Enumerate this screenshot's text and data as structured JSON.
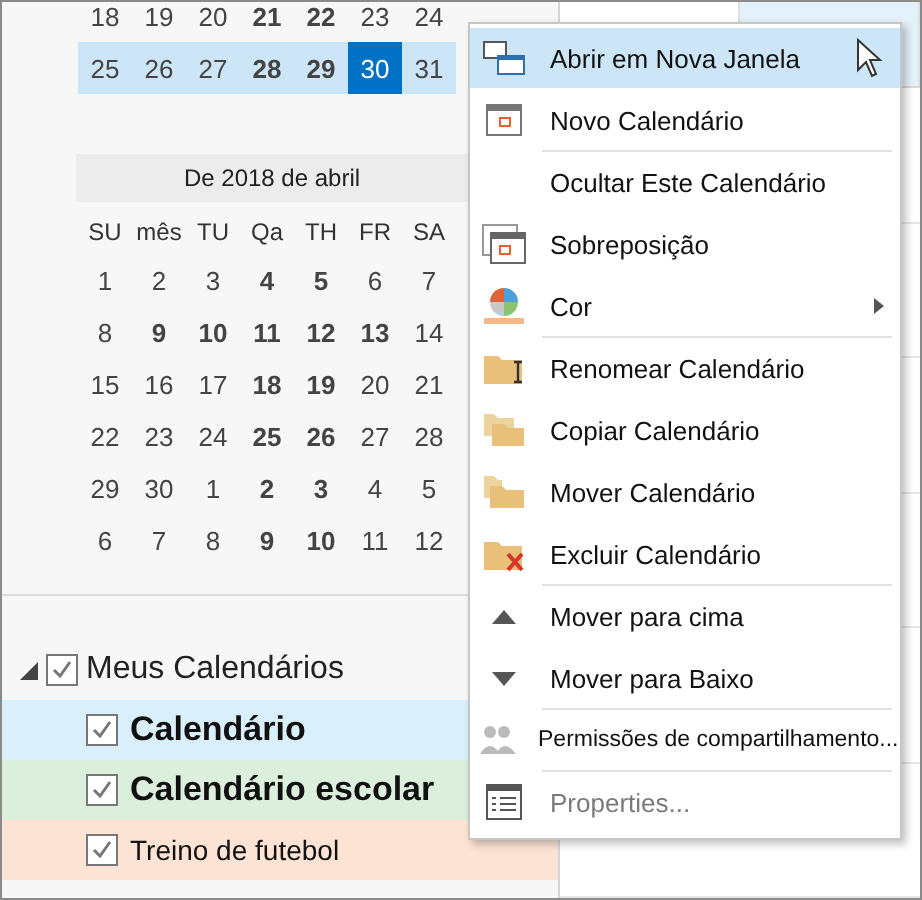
{
  "top_weeks": [
    {
      "highlighted": false,
      "days": [
        {
          "d": "18",
          "busy": false,
          "selected": false
        },
        {
          "d": "19",
          "busy": false,
          "selected": false
        },
        {
          "d": "20",
          "busy": false,
          "selected": false
        },
        {
          "d": "21",
          "busy": true,
          "selected": false
        },
        {
          "d": "22",
          "busy": true,
          "selected": false
        },
        {
          "d": "23",
          "busy": false,
          "selected": false
        },
        {
          "d": "24",
          "busy": false,
          "selected": false
        }
      ]
    },
    {
      "highlighted": true,
      "days": [
        {
          "d": "25",
          "busy": false,
          "selected": false
        },
        {
          "d": "26",
          "busy": false,
          "selected": false
        },
        {
          "d": "27",
          "busy": false,
          "selected": false
        },
        {
          "d": "28",
          "busy": true,
          "selected": false
        },
        {
          "d": "29",
          "busy": true,
          "selected": false
        },
        {
          "d": "30",
          "busy": false,
          "selected": true
        },
        {
          "d": "31",
          "busy": false,
          "selected": false
        }
      ]
    }
  ],
  "month": {
    "title": "De 2018 de abril",
    "weekdays": [
      "SU",
      "mês",
      "TU",
      "Qa",
      "TH",
      "FR",
      "SA"
    ],
    "weeks": [
      {
        "highlighted": false,
        "days": [
          {
            "d": "1",
            "busy": false,
            "selected": false
          },
          {
            "d": "2",
            "busy": false,
            "selected": false
          },
          {
            "d": "3",
            "busy": false,
            "selected": false
          },
          {
            "d": "4",
            "busy": true,
            "selected": false
          },
          {
            "d": "5",
            "busy": true,
            "selected": false
          },
          {
            "d": "6",
            "busy": false,
            "selected": false
          },
          {
            "d": "7",
            "busy": false,
            "selected": false
          }
        ]
      },
      {
        "highlighted": false,
        "days": [
          {
            "d": "8",
            "busy": false,
            "selected": false
          },
          {
            "d": "9",
            "busy": true,
            "selected": false
          },
          {
            "d": "10",
            "busy": true,
            "selected": false
          },
          {
            "d": "11",
            "busy": true,
            "selected": false
          },
          {
            "d": "12",
            "busy": true,
            "selected": false
          },
          {
            "d": "13",
            "busy": true,
            "selected": false
          },
          {
            "d": "14",
            "busy": false,
            "selected": false
          }
        ]
      },
      {
        "highlighted": false,
        "days": [
          {
            "d": "15",
            "busy": false,
            "selected": false
          },
          {
            "d": "16",
            "busy": false,
            "selected": false
          },
          {
            "d": "17",
            "busy": false,
            "selected": false
          },
          {
            "d": "18",
            "busy": true,
            "selected": false
          },
          {
            "d": "19",
            "busy": true,
            "selected": false
          },
          {
            "d": "20",
            "busy": false,
            "selected": false
          },
          {
            "d": "21",
            "busy": false,
            "selected": false
          }
        ]
      },
      {
        "highlighted": false,
        "days": [
          {
            "d": "22",
            "busy": false,
            "selected": false
          },
          {
            "d": "23",
            "busy": false,
            "selected": false
          },
          {
            "d": "24",
            "busy": false,
            "selected": false
          },
          {
            "d": "25",
            "busy": true,
            "selected": false
          },
          {
            "d": "26",
            "busy": true,
            "selected": false
          },
          {
            "d": "27",
            "busy": false,
            "selected": false
          },
          {
            "d": "28",
            "busy": false,
            "selected": false
          }
        ]
      },
      {
        "highlighted": false,
        "days": [
          {
            "d": "29",
            "busy": false,
            "selected": false
          },
          {
            "d": "30",
            "busy": false,
            "selected": false
          },
          {
            "d": "1",
            "busy": false,
            "selected": false
          },
          {
            "d": "2",
            "busy": true,
            "selected": false
          },
          {
            "d": "3",
            "busy": true,
            "selected": false
          },
          {
            "d": "4",
            "busy": false,
            "selected": false
          },
          {
            "d": "5",
            "busy": false,
            "selected": false
          }
        ]
      },
      {
        "highlighted": false,
        "days": [
          {
            "d": "6",
            "busy": false,
            "selected": false
          },
          {
            "d": "7",
            "busy": false,
            "selected": false
          },
          {
            "d": "8",
            "busy": false,
            "selected": false
          },
          {
            "d": "9",
            "busy": true,
            "selected": false
          },
          {
            "d": "10",
            "busy": true,
            "selected": false
          },
          {
            "d": "11",
            "busy": false,
            "selected": false
          },
          {
            "d": "12",
            "busy": false,
            "selected": false
          }
        ]
      }
    ]
  },
  "calendar_group": {
    "label": "Meus Calendários",
    "expanded": true,
    "checked": true,
    "children": [
      {
        "label": "Calendário",
        "checked": true,
        "bold": true,
        "color": "#daeffc"
      },
      {
        "label": "Calendário escolar",
        "checked": true,
        "bold": true,
        "color": "#dcefdc"
      },
      {
        "label": "Treino de futebol",
        "checked": true,
        "bold": false,
        "color": "#fce3d4"
      }
    ]
  },
  "context_menu": [
    {
      "kind": "new-window",
      "label": "Abrir em Nova Janela",
      "selected": true,
      "disabled": false,
      "submenu": false,
      "separator_after": false
    },
    {
      "kind": "calendar",
      "label": "Novo Calendário",
      "selected": false,
      "disabled": false,
      "submenu": false,
      "separator_after": true
    },
    {
      "kind": "none",
      "label": "Ocultar Este Calendário",
      "selected": false,
      "disabled": false,
      "submenu": false,
      "separator_after": false
    },
    {
      "kind": "overlay",
      "label": "Sobreposição",
      "selected": false,
      "disabled": false,
      "submenu": false,
      "separator_after": false
    },
    {
      "kind": "color",
      "label": "Cor",
      "selected": false,
      "disabled": false,
      "submenu": true,
      "separator_after": true
    },
    {
      "kind": "rename",
      "label": "Renomear Calendário",
      "selected": false,
      "disabled": false,
      "submenu": false,
      "separator_after": false
    },
    {
      "kind": "copy",
      "label": "Copiar Calendário",
      "selected": false,
      "disabled": false,
      "submenu": false,
      "separator_after": false
    },
    {
      "kind": "move",
      "label": "Mover Calendário",
      "selected": false,
      "disabled": false,
      "submenu": false,
      "separator_after": false
    },
    {
      "kind": "delete",
      "label": "Excluir Calendário",
      "selected": false,
      "disabled": false,
      "submenu": false,
      "separator_after": true
    },
    {
      "kind": "up",
      "label": "Mover para cima",
      "selected": false,
      "disabled": false,
      "submenu": false,
      "separator_after": false
    },
    {
      "kind": "down",
      "label": "Mover para Baixo",
      "selected": false,
      "disabled": false,
      "submenu": false,
      "separator_after": true
    },
    {
      "kind": "people",
      "label": "Permissões de compartilhamento...",
      "selected": false,
      "disabled": false,
      "submenu": false,
      "separator_after": true
    },
    {
      "kind": "list",
      "label": "Properties...",
      "selected": false,
      "disabled": true,
      "submenu": false,
      "separator_after": false
    }
  ]
}
